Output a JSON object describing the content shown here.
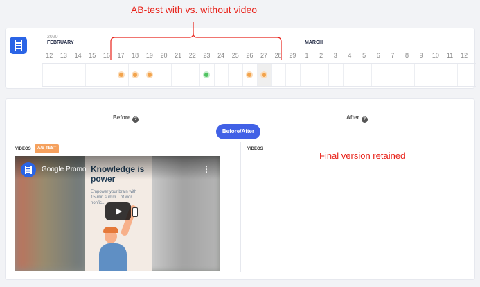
{
  "annotations": {
    "top": "AB-test with vs. without video",
    "final": "Final version retained"
  },
  "timeline": {
    "year": "2020",
    "months": [
      "FEBRUARY",
      "MARCH"
    ],
    "days": [
      "12",
      "13",
      "14",
      "15",
      "16",
      "17",
      "18",
      "19",
      "20",
      "21",
      "22",
      "23",
      "24",
      "25",
      "26",
      "27",
      "28",
      "29",
      "1",
      "2",
      "3",
      "4",
      "5",
      "6",
      "7",
      "8",
      "9",
      "10",
      "11",
      "12"
    ]
  },
  "comparison": {
    "before_label": "Before",
    "after_label": "After",
    "toggle_label": "Before/After",
    "videos_label_left": "VIDEOS",
    "ab_badge": "A/B TEST",
    "videos_label_right": "VIDEOS"
  },
  "video": {
    "title": "Google Promo",
    "menu": "⋮",
    "poster_headline": "Knowledge is power",
    "poster_body": "Empower your brain with 15-min summ... of wor... nonfic..."
  },
  "colors": {
    "accent": "#2a64e6",
    "toggle": "#4161e6",
    "annotation": "#e8231b",
    "badge": "#f5a15e",
    "dot_orange": "#f2a34c",
    "dot_green": "#4fc361"
  }
}
